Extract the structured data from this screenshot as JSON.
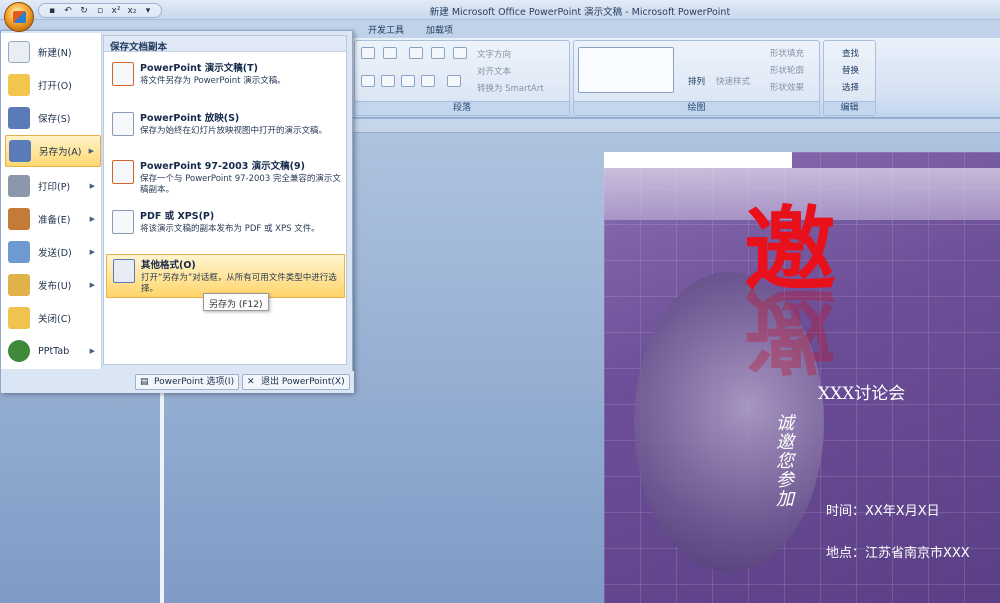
{
  "window": {
    "title": "新建 Microsoft Office PowerPoint 演示文稿 - Microsoft PowerPoint"
  },
  "quick_access": [
    "save-icon",
    "undo-icon",
    "redo-icon",
    "print-preview-icon",
    "superscript-icon",
    "subscript-icon"
  ],
  "ribbon_tabs": [
    "开发工具",
    "加载项"
  ],
  "ribbon": {
    "paragraph": {
      "label": "段落",
      "text_direction": "文字方向",
      "align_text": "对齐文本",
      "smartart": "转换为 SmartArt"
    },
    "drawing": {
      "label": "绘图",
      "arrange": "排列",
      "quick_styles": "快速样式",
      "shape_fill": "形状填充",
      "shape_outline": "形状轮廓",
      "shape_effects": "形状效果"
    },
    "editing": {
      "label": "编辑",
      "find": "查找",
      "replace": "替换",
      "select": "选择"
    }
  },
  "office_menu": {
    "items": [
      {
        "label": "新建(N)",
        "arrow": false
      },
      {
        "label": "打开(O)",
        "arrow": false
      },
      {
        "label": "保存(S)",
        "arrow": false
      },
      {
        "label": "另存为(A)",
        "arrow": true,
        "selected": true
      },
      {
        "label": "打印(P)",
        "arrow": true
      },
      {
        "label": "准备(E)",
        "arrow": true
      },
      {
        "label": "发送(D)",
        "arrow": true
      },
      {
        "label": "发布(U)",
        "arrow": true
      },
      {
        "label": "关闭(C)",
        "arrow": false
      },
      {
        "label": "PPtTab",
        "arrow": true
      }
    ],
    "submenu_title": "保存文档副本",
    "submenu_items": [
      {
        "title": "PowerPoint 演示文稿(T)",
        "desc": "将文件另存为 PowerPoint 演示文稿。"
      },
      {
        "title": "PowerPoint 放映(S)",
        "desc": "保存为始终在幻灯片放映视图中打开的演示文稿。"
      },
      {
        "title": "PowerPoint 97-2003 演示文稿(9)",
        "desc": "保存一个与 PowerPoint 97-2003 完全兼容的演示文稿副本。"
      },
      {
        "title": "PDF 或 XPS(P)",
        "desc": "将该演示文稿的副本发布为 PDF 或 XPS 文件。"
      },
      {
        "title": "其他格式(O)",
        "desc": "打开“另存为”对话框，从所有可用文件类型中进行选择。",
        "selected": true
      }
    ],
    "options_button": "PowerPoint 选项(I)",
    "exit_button": "退出 PowerPoint(X)"
  },
  "tooltip": "另存为 (F12)",
  "slide": {
    "big_char": "邀",
    "vertical_text": "诚邀您参加",
    "title": "XXX讨论会",
    "time": "时间：XX年X月X日",
    "place": "地点：江苏省南京市XXX"
  }
}
